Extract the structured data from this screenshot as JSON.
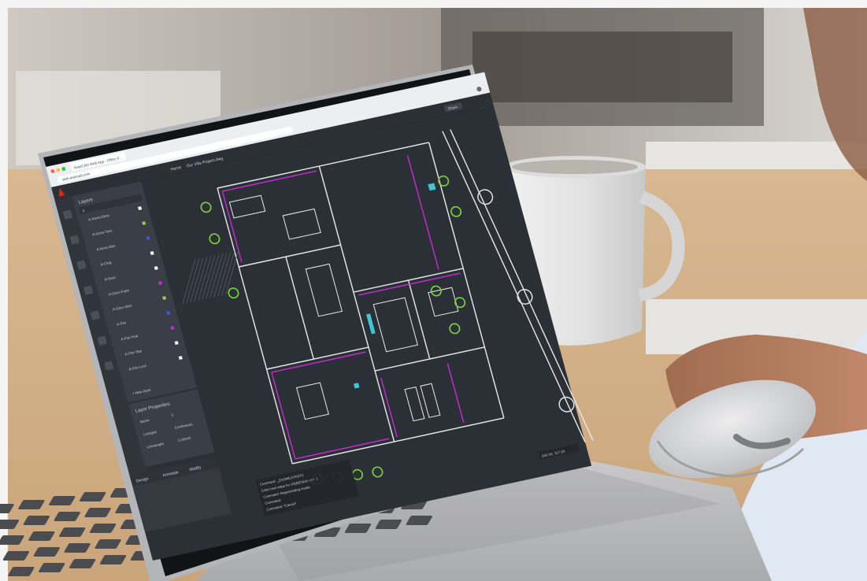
{
  "photo": {
    "subject": "laptop-running-web-cad-app"
  },
  "browser": {
    "tab_title": "AutoCAD Web App - Office F...",
    "url": "web.autocad.com"
  },
  "app": {
    "header_title": "Home",
    "file_name": "Our Villa Project.dwg",
    "top_right_button": "Share"
  },
  "layers_panel": {
    "title": "Layers",
    "current_layer": "0",
    "items": [
      {
        "name": "A-Anno-Dims",
        "color": "#ffffff"
      },
      {
        "name": "A-Anno-Text",
        "color": "#8fd14f"
      },
      {
        "name": "A-Area-Iden",
        "color": "#3b5bdb"
      },
      {
        "name": "A-Clng",
        "color": "#ffffff"
      },
      {
        "name": "A-Door",
        "color": "#ffffff"
      },
      {
        "name": "A-Door-Fram",
        "color": "#c62ad1"
      },
      {
        "name": "A-Door-Iden",
        "color": "#8fd14f"
      },
      {
        "name": "A-Flor",
        "color": "#3b5bdb"
      },
      {
        "name": "A-Flor-Hral",
        "color": "#c62ad1"
      },
      {
        "name": "A-Flor-Stai",
        "color": "#ffffff"
      },
      {
        "name": "A-Flor-Levl",
        "color": "#ffffff"
      }
    ],
    "new_layer_button": "+ New layer"
  },
  "layer_properties": {
    "title": "Layer Properties",
    "rows": [
      {
        "label": "Name",
        "value": "0"
      },
      {
        "label": "Linetype",
        "value": "Continuous"
      },
      {
        "label": "Lineweight",
        "value": "0.00mm"
      }
    ]
  },
  "bottom_tabs": [
    "Design",
    "Annotate",
    "Modify"
  ],
  "command_line": [
    "Command: _ZOOMEXTENTS",
    "Enter new value for VISRETAIN <1>: 1",
    "Command: Regenerating model.",
    "Command:",
    "Command: *Cancel*"
  ],
  "status_bar": {
    "coordinates": "240.34, 117.20"
  },
  "colors": {
    "canvas": "#2b2f36",
    "panel": "#3a3e46",
    "accent": "#e2231a",
    "cad_magenta": "#c62ad1",
    "cad_white": "#e8e8e8",
    "cad_green": "#7bd13a",
    "cad_cyan": "#3fc6d6"
  }
}
